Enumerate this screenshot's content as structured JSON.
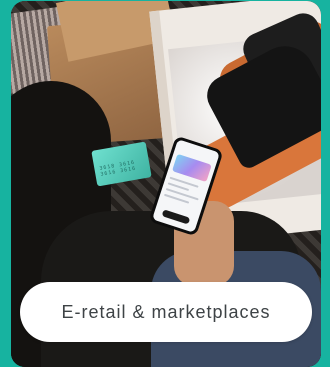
{
  "category": {
    "label": "E-retail & marketplaces"
  },
  "photo": {
    "card_number_text": "3618 3616 3616 3616"
  }
}
